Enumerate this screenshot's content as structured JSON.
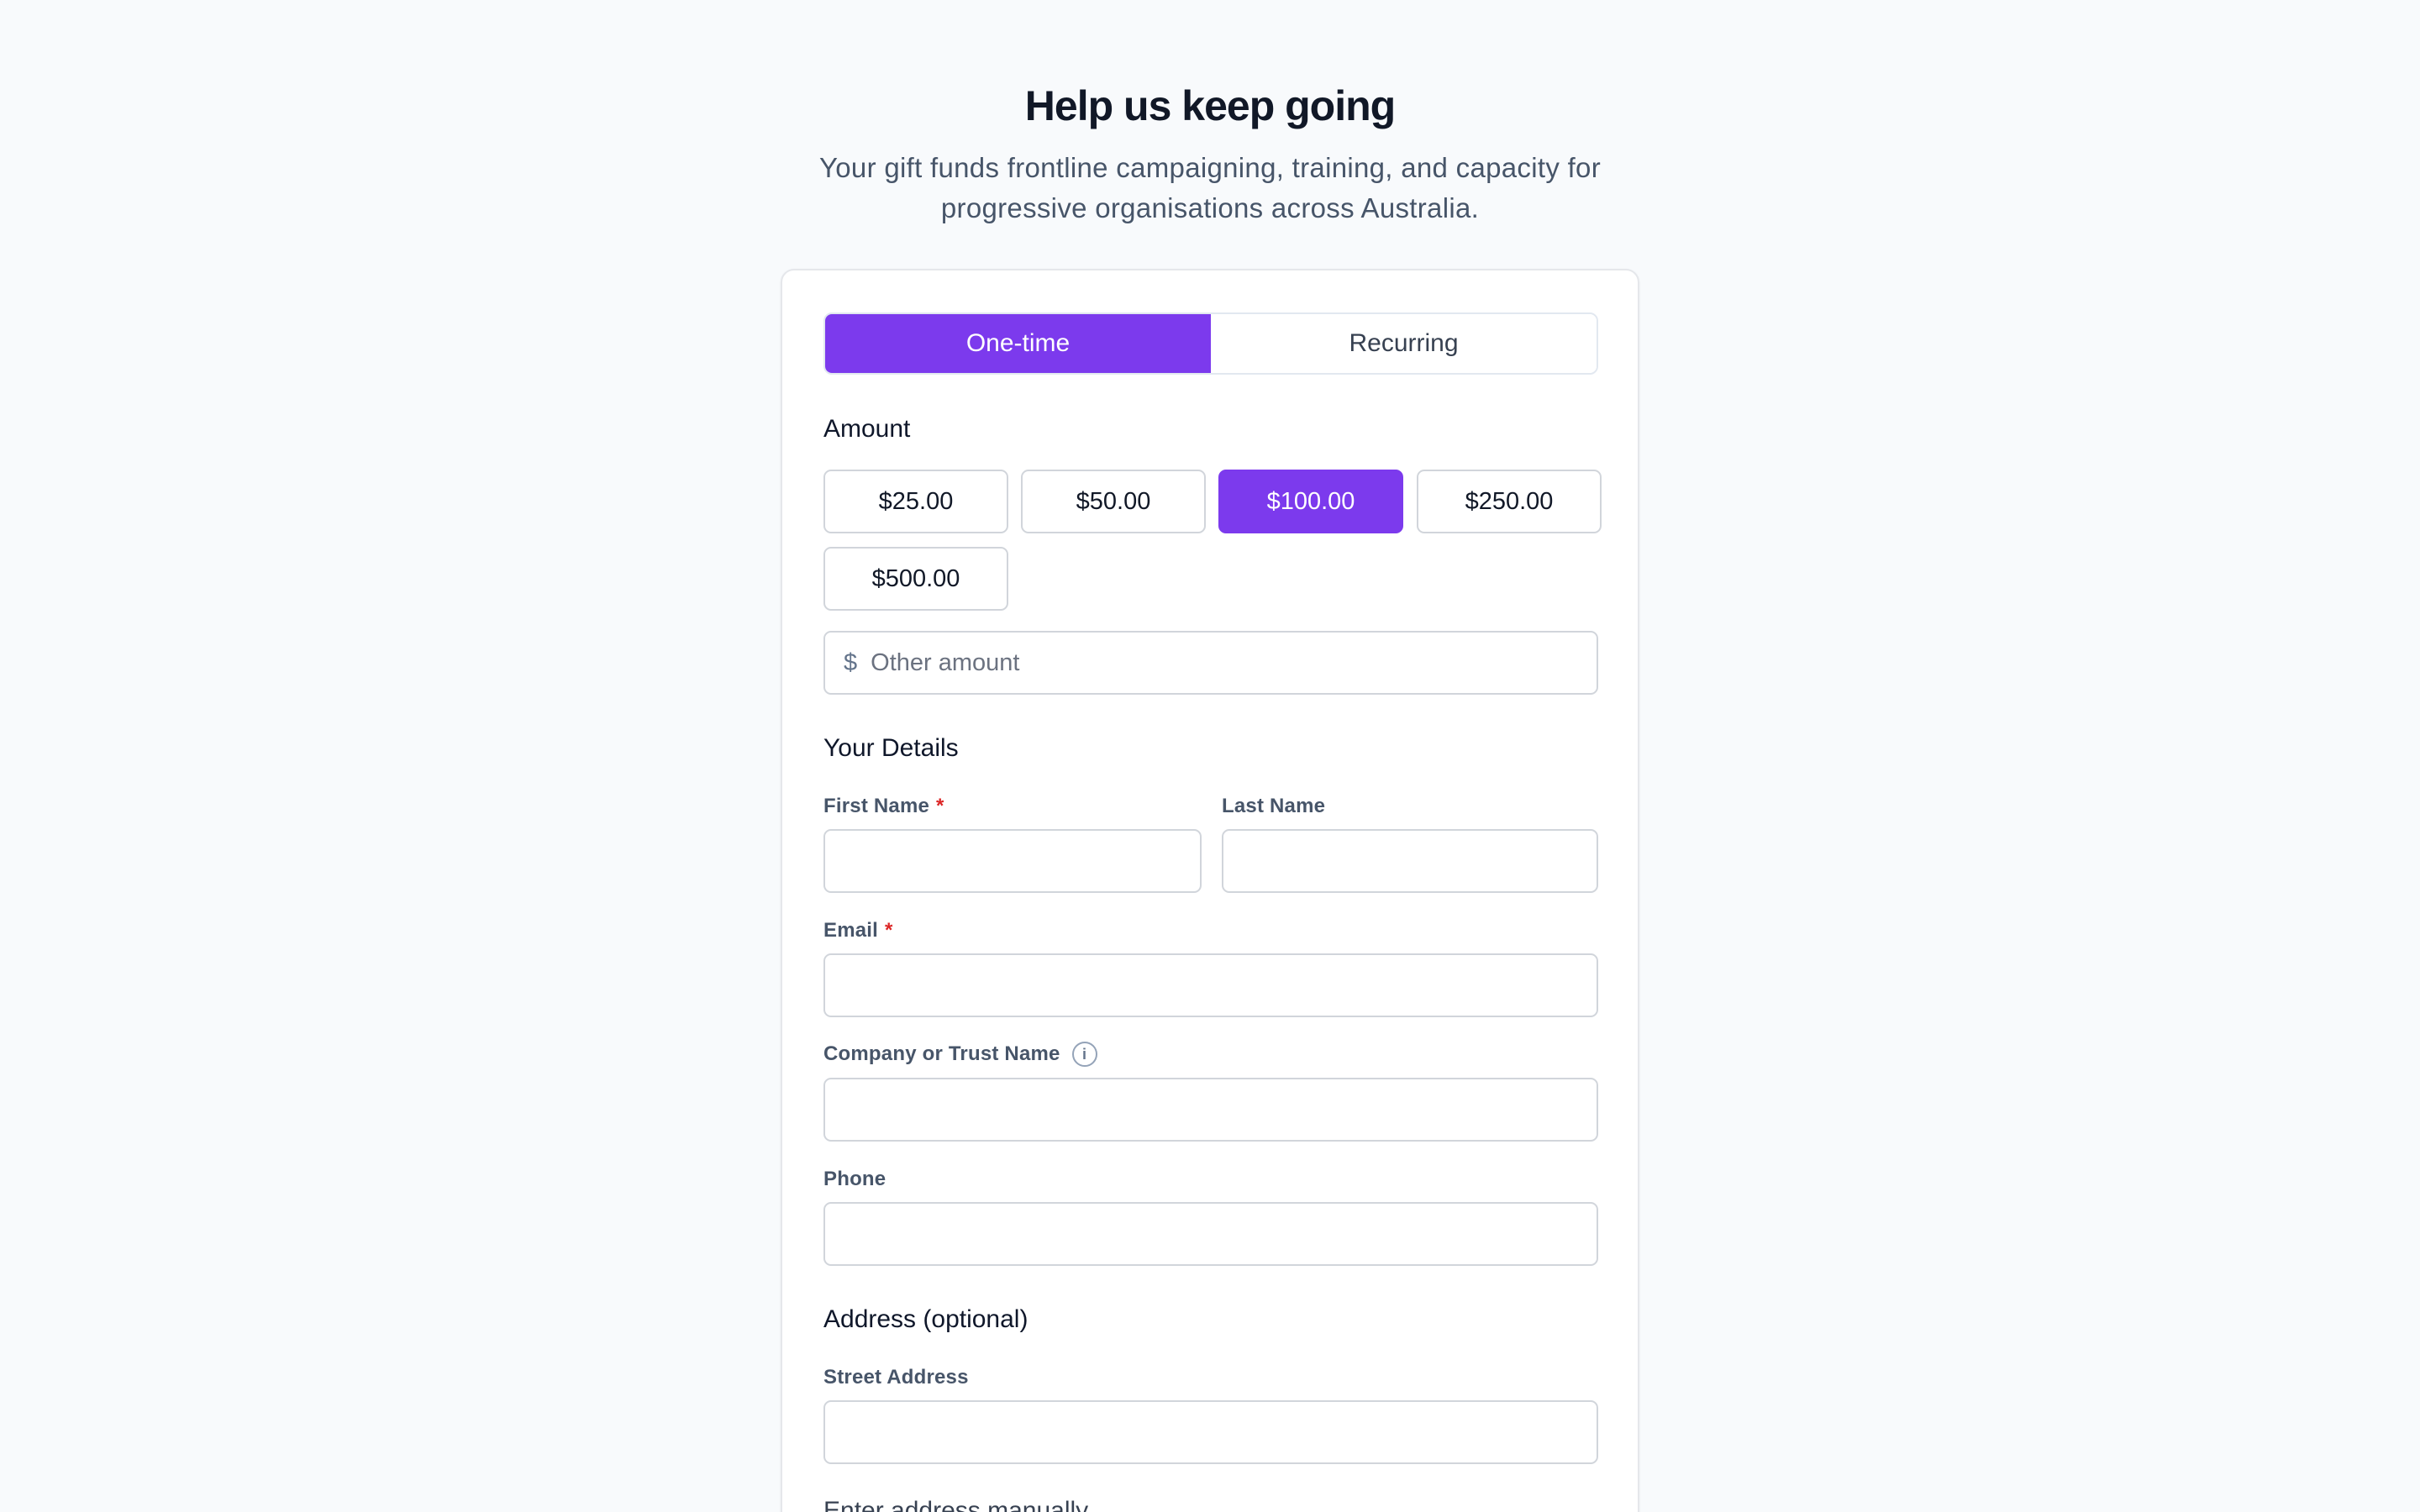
{
  "header": {
    "title": "Help us keep going",
    "subtitle": "Your gift funds frontline campaigning, training, and capacity for progressive organisations across Australia."
  },
  "frequency": {
    "options": [
      "One-time",
      "Recurring"
    ],
    "selected": "One-time"
  },
  "amount": {
    "label": "Amount",
    "options": [
      "$25.00",
      "$50.00",
      "$100.00",
      "$250.00",
      "$500.00"
    ],
    "selected": "$100.00",
    "other_prefix": "$",
    "other_placeholder": "Other amount"
  },
  "details": {
    "label": "Your Details",
    "first_name_label": "First Name",
    "last_name_label": "Last Name",
    "email_label": "Email",
    "company_label": "Company or Trust Name",
    "info_glyph": "i",
    "phone_label": "Phone",
    "required_marker": "*"
  },
  "address": {
    "label": "Address (optional)",
    "street_label": "Street Address",
    "manual_link": "Enter address manually"
  },
  "colors": {
    "accent": "#7c3aed",
    "required": "#dc2626"
  }
}
